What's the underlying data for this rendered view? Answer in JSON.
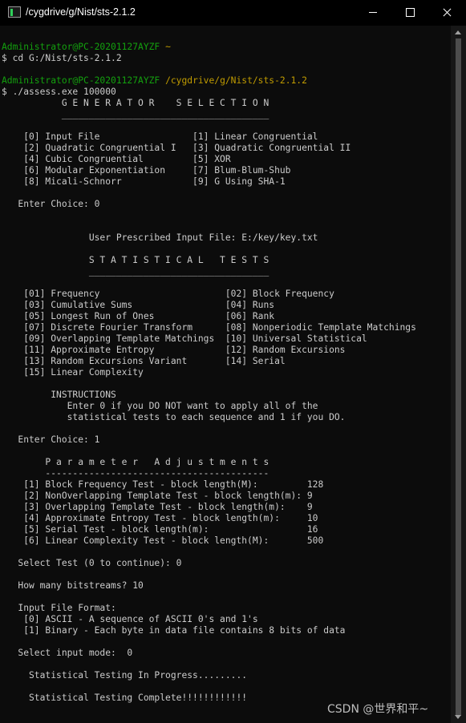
{
  "window": {
    "title": "/cygdrive/g/Nist/sts-2.1.2"
  },
  "terminal": {
    "lines": [
      {
        "segs": [
          {
            "text": "",
            "c": "w"
          }
        ]
      },
      {
        "segs": [
          {
            "text": "Administrator@PC-20201127AYZF",
            "c": "g"
          },
          {
            "text": " ",
            "c": "w"
          },
          {
            "text": "~",
            "c": "y"
          }
        ]
      },
      {
        "segs": [
          {
            "text": "$ cd G:/Nist/sts-2.1.2",
            "c": "w"
          }
        ]
      },
      {
        "segs": [
          {
            "text": "",
            "c": "w"
          }
        ]
      },
      {
        "segs": [
          {
            "text": "Administrator@PC-20201127AYZF",
            "c": "g"
          },
          {
            "text": " ",
            "c": "w"
          },
          {
            "text": "/cygdrive/g/Nist/sts-2.1.2",
            "c": "y"
          }
        ]
      },
      {
        "segs": [
          {
            "text": "$ ./assess.exe 100000",
            "c": "w"
          }
        ]
      },
      {
        "segs": [
          {
            "text": "           G E N E R A T O R    S E L E C T I O N",
            "c": "w"
          }
        ]
      },
      {
        "segs": [
          {
            "text": "           ______________________________________",
            "c": "w"
          }
        ]
      },
      {
        "segs": [
          {
            "text": "",
            "c": "w"
          }
        ]
      },
      {
        "segs": [
          {
            "text": "    [0] Input File                 [1] Linear Congruential",
            "c": "w"
          }
        ]
      },
      {
        "segs": [
          {
            "text": "    [2] Quadratic Congruential I   [3] Quadratic Congruential II",
            "c": "w"
          }
        ]
      },
      {
        "segs": [
          {
            "text": "    [4] Cubic Congruential         [5] XOR",
            "c": "w"
          }
        ]
      },
      {
        "segs": [
          {
            "text": "    [6] Modular Exponentiation     [7] Blum-Blum-Shub",
            "c": "w"
          }
        ]
      },
      {
        "segs": [
          {
            "text": "    [8] Micali-Schnorr             [9] G Using SHA-1",
            "c": "w"
          }
        ]
      },
      {
        "segs": [
          {
            "text": "",
            "c": "w"
          }
        ]
      },
      {
        "segs": [
          {
            "text": "   Enter Choice: 0",
            "c": "w"
          }
        ]
      },
      {
        "segs": [
          {
            "text": "",
            "c": "w"
          }
        ]
      },
      {
        "segs": [
          {
            "text": "",
            "c": "w"
          }
        ]
      },
      {
        "segs": [
          {
            "text": "                User Prescribed Input File: E:/key/key.txt",
            "c": "w"
          }
        ]
      },
      {
        "segs": [
          {
            "text": "",
            "c": "w"
          }
        ]
      },
      {
        "segs": [
          {
            "text": "                S T A T I S T I C A L   T E S T S",
            "c": "w"
          }
        ]
      },
      {
        "segs": [
          {
            "text": "                _________________________________",
            "c": "w"
          }
        ]
      },
      {
        "segs": [
          {
            "text": "",
            "c": "w"
          }
        ]
      },
      {
        "segs": [
          {
            "text": "    [01] Frequency                       [02] Block Frequency",
            "c": "w"
          }
        ]
      },
      {
        "segs": [
          {
            "text": "    [03] Cumulative Sums                 [04] Runs",
            "c": "w"
          }
        ]
      },
      {
        "segs": [
          {
            "text": "    [05] Longest Run of Ones             [06] Rank",
            "c": "w"
          }
        ]
      },
      {
        "segs": [
          {
            "text": "    [07] Discrete Fourier Transform      [08] Nonperiodic Template Matchings",
            "c": "w"
          }
        ]
      },
      {
        "segs": [
          {
            "text": "    [09] Overlapping Template Matchings  [10] Universal Statistical",
            "c": "w"
          }
        ]
      },
      {
        "segs": [
          {
            "text": "    [11] Approximate Entropy             [12] Random Excursions",
            "c": "w"
          }
        ]
      },
      {
        "segs": [
          {
            "text": "    [13] Random Excursions Variant       [14] Serial",
            "c": "w"
          }
        ]
      },
      {
        "segs": [
          {
            "text": "    [15] Linear Complexity",
            "c": "w"
          }
        ]
      },
      {
        "segs": [
          {
            "text": "",
            "c": "w"
          }
        ]
      },
      {
        "segs": [
          {
            "text": "         INSTRUCTIONS",
            "c": "w"
          }
        ]
      },
      {
        "segs": [
          {
            "text": "            Enter 0 if you DO NOT want to apply all of the",
            "c": "w"
          }
        ]
      },
      {
        "segs": [
          {
            "text": "            statistical tests to each sequence and 1 if you DO.",
            "c": "w"
          }
        ]
      },
      {
        "segs": [
          {
            "text": "",
            "c": "w"
          }
        ]
      },
      {
        "segs": [
          {
            "text": "   Enter Choice: 1",
            "c": "w"
          }
        ]
      },
      {
        "segs": [
          {
            "text": "",
            "c": "w"
          }
        ]
      },
      {
        "segs": [
          {
            "text": "        P a r a m e t e r   A d j u s t m e n t s",
            "c": "w"
          }
        ]
      },
      {
        "segs": [
          {
            "text": "        -----------------------------------------",
            "c": "w"
          }
        ]
      },
      {
        "segs": [
          {
            "text": "    [1] Block Frequency Test - block length(M):         128",
            "c": "w"
          }
        ]
      },
      {
        "segs": [
          {
            "text": "    [2] NonOverlapping Template Test - block length(m): 9",
            "c": "w"
          }
        ]
      },
      {
        "segs": [
          {
            "text": "    [3] Overlapping Template Test - block length(m):    9",
            "c": "w"
          }
        ]
      },
      {
        "segs": [
          {
            "text": "    [4] Approximate Entropy Test - block length(m):     10",
            "c": "w"
          }
        ]
      },
      {
        "segs": [
          {
            "text": "    [5] Serial Test - block length(m):                  16",
            "c": "w"
          }
        ]
      },
      {
        "segs": [
          {
            "text": "    [6] Linear Complexity Test - block length(M):       500",
            "c": "w"
          }
        ]
      },
      {
        "segs": [
          {
            "text": "",
            "c": "w"
          }
        ]
      },
      {
        "segs": [
          {
            "text": "   Select Test (0 to continue): 0",
            "c": "w"
          }
        ]
      },
      {
        "segs": [
          {
            "text": "",
            "c": "w"
          }
        ]
      },
      {
        "segs": [
          {
            "text": "   How many bitstreams? 10",
            "c": "w"
          }
        ]
      },
      {
        "segs": [
          {
            "text": "",
            "c": "w"
          }
        ]
      },
      {
        "segs": [
          {
            "text": "   Input File Format:",
            "c": "w"
          }
        ]
      },
      {
        "segs": [
          {
            "text": "    [0] ASCII - A sequence of ASCII 0's and 1's",
            "c": "w"
          }
        ]
      },
      {
        "segs": [
          {
            "text": "    [1] Binary - Each byte in data file contains 8 bits of data",
            "c": "w"
          }
        ]
      },
      {
        "segs": [
          {
            "text": "",
            "c": "w"
          }
        ]
      },
      {
        "segs": [
          {
            "text": "   Select input mode:  0",
            "c": "w"
          }
        ]
      },
      {
        "segs": [
          {
            "text": "",
            "c": "w"
          }
        ]
      },
      {
        "segs": [
          {
            "text": "     Statistical Testing In Progress.........",
            "c": "w"
          }
        ]
      },
      {
        "segs": [
          {
            "text": "",
            "c": "w"
          }
        ]
      },
      {
        "segs": [
          {
            "text": "     Statistical Testing Complete!!!!!!!!!!!!",
            "c": "w"
          }
        ]
      }
    ]
  },
  "watermark": "CSDN @世界和平~",
  "colors": {
    "background": "#0c0c0c",
    "text": "#cccccc",
    "green": "#13a10e",
    "yellow": "#c19c00"
  }
}
